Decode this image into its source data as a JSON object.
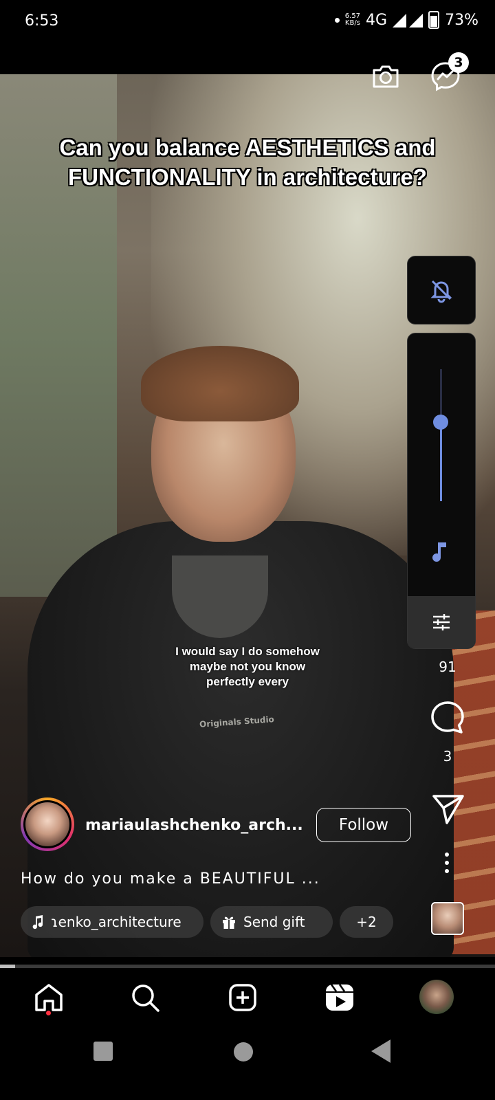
{
  "status_bar": {
    "time": "6:53",
    "speed_value": "6.57",
    "speed_unit": "KB/s",
    "network": "4G",
    "battery": "73%",
    "battery_level": 0.73
  },
  "header": {
    "camera_icon": "camera-icon",
    "messenger_icon": "messenger-icon",
    "messenger_badge": "3"
  },
  "video": {
    "title_line1": "Can you balance AESTHETICS and",
    "title_line2": "FUNCTIONALITY in architecture?",
    "subtitle_line1": "I would say I do somehow",
    "subtitle_line2": "maybe not you know",
    "subtitle_line3": "perfectly every",
    "shirt_text": "Originals Studio"
  },
  "volume": {
    "mute_icon": "bell-off-icon",
    "level": 0.6,
    "music_icon": "music-note-icon",
    "settings_icon": "sliders-icon",
    "accent_color": "#6f8de0"
  },
  "actions": {
    "likes": "91",
    "comments": "3",
    "comment_icon": "comment-icon",
    "share_icon": "send-icon",
    "more_icon": "more-vertical-icon"
  },
  "post": {
    "username": "mariaulashchenko_arch...",
    "follow_label": "Follow",
    "caption": "How do you make a BEAUTIFUL ...",
    "audio_chip": "ɿenko_architecture",
    "gift_chip": "Send gift",
    "more_chip": "+2"
  },
  "progress": {
    "fraction": 0.03
  },
  "bottom_nav": {
    "items": [
      "home-icon",
      "search-icon",
      "create-icon",
      "reels-icon",
      "profile-avatar"
    ]
  }
}
